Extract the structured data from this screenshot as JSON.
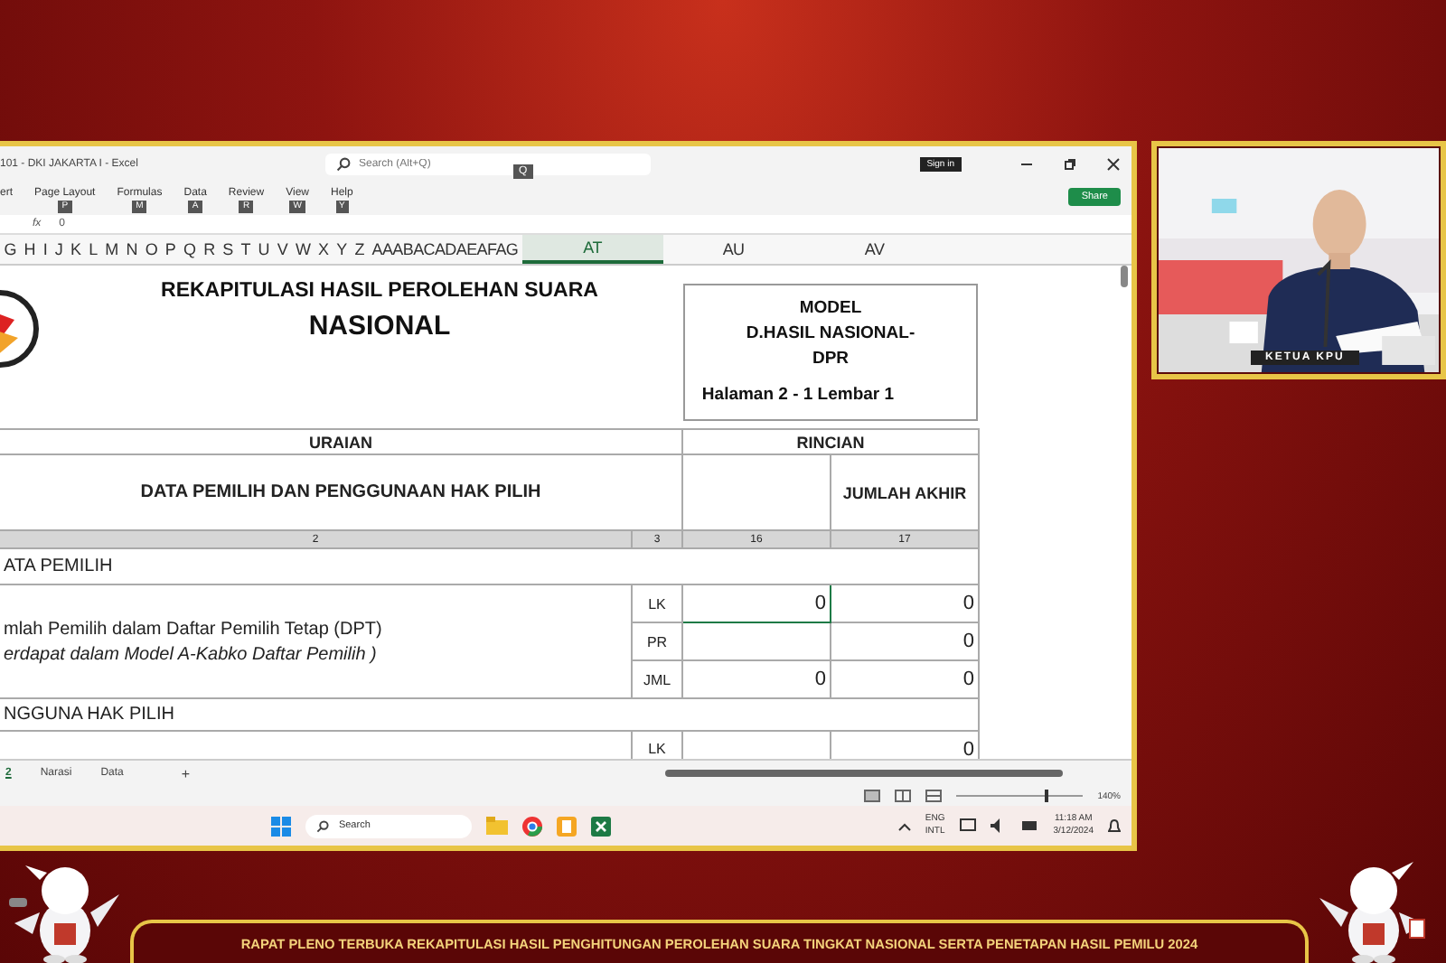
{
  "window": {
    "title": "101 - DKI JAKARTA I - Excel",
    "search": {
      "placeholder": "Search (Alt+Q)",
      "keytip": "Q"
    },
    "sign_in": "Sign in",
    "share": "Share"
  },
  "ribbon_tabs": [
    {
      "label": "ert"
    },
    {
      "label": "Page Layout",
      "keytip": "P"
    },
    {
      "label": "Formulas",
      "keytip": "M"
    },
    {
      "label": "Data",
      "keytip": "A"
    },
    {
      "label": "Review",
      "keytip": "R"
    },
    {
      "label": "View",
      "keytip": "W"
    },
    {
      "label": "Help",
      "keytip": "Y"
    }
  ],
  "formula_bar": {
    "fx": "fx",
    "value": "0"
  },
  "column_headers": [
    {
      "label": "G",
      "selected": false
    },
    {
      "label": "H",
      "selected": false
    },
    {
      "label": "I",
      "selected": false
    },
    {
      "label": "J",
      "selected": false
    },
    {
      "label": "K",
      "selected": false
    },
    {
      "label": "L",
      "selected": false
    },
    {
      "label": "M",
      "selected": false
    },
    {
      "label": "N",
      "selected": false
    },
    {
      "label": "O",
      "selected": false
    },
    {
      "label": "P",
      "selected": false
    },
    {
      "label": "Q",
      "selected": false
    },
    {
      "label": "R",
      "selected": false
    },
    {
      "label": "S",
      "selected": false
    },
    {
      "label": "T",
      "selected": false
    },
    {
      "label": "U",
      "selected": false
    },
    {
      "label": "V",
      "selected": false
    },
    {
      "label": "W",
      "selected": false
    },
    {
      "label": "X",
      "selected": false
    },
    {
      "label": "Y",
      "selected": false
    },
    {
      "label": "Z",
      "selected": false
    },
    {
      "label": "AAABACADAEAFAG",
      "selected": false
    },
    {
      "label": "AT",
      "selected": true
    },
    {
      "label": "AU",
      "selected": false
    },
    {
      "label": "AV",
      "selected": false
    }
  ],
  "sheet": {
    "title": "REKAPITULASI HASIL PEROLEHAN SUARA",
    "subtitle": "NASIONAL",
    "model": [
      "MODEL",
      "D.HASIL NASIONAL-",
      "DPR"
    ],
    "page": "Halaman 2 - 1 Lembar 1",
    "uraian": "URAIAN",
    "rincian": "RINCIAN",
    "data_heading": "DATA PEMILIH DAN PENGGUNAAN HAK PILIH",
    "jumlah_akhir": "JUMLAH AKHIR",
    "col_numbers": [
      "2",
      "3",
      "16",
      "17"
    ],
    "section_1": "ATA PEMILIH",
    "item_1": "mlah Pemilih dalam Daftar Pemilih Tetap (DPT)",
    "item_1_note": "erdapat dalam Model A-Kabko Daftar Pemilih )",
    "rows": [
      {
        "code": "LK",
        "col_16": "0",
        "col_17": "0"
      },
      {
        "code": "PR",
        "col_16": "",
        "col_17": "0"
      },
      {
        "code": "JML",
        "col_16": "0",
        "col_17": "0"
      }
    ],
    "section_2": "NGGUNA HAK PILIH",
    "last_row": {
      "code": "LK",
      "col_17": "0"
    }
  },
  "sheet_tabs": [
    {
      "label": "2",
      "selected": true
    },
    {
      "label": "Narasi",
      "selected": false
    },
    {
      "label": "Data",
      "selected": false
    }
  ],
  "add_sheet": "+",
  "zoom": {
    "label": "140%",
    "level": 0.7
  },
  "taskbar": {
    "search": "Search",
    "language": [
      "ENG",
      "INTL"
    ],
    "time": "11:18 AM",
    "date": "3/12/2024"
  },
  "inset": {
    "caption": "KETUA KPU"
  },
  "banner": "RAPAT PLENO TERBUKA REKAPITULASI HASIL PENGHITUNGAN PEROLEHAN SUARA TINGKAT NASIONAL SERTA PENETAPAN HASIL PEMILU 2024"
}
